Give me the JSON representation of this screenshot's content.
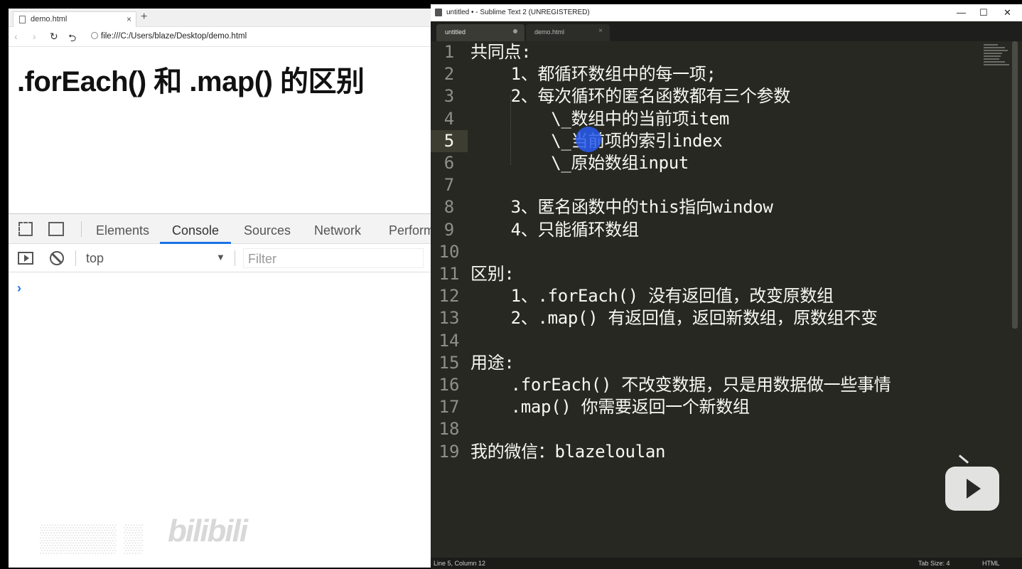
{
  "browser": {
    "tab_title": "demo.html",
    "tab_close": "×",
    "new_tab": "+",
    "nav_back": "‹",
    "nav_forward": "›",
    "nav_reload": "↻",
    "nav_home": "⮌",
    "url": "file:///C:/Users/blaze/Desktop/demo.html",
    "heading": ".forEach() 和 .map() 的区别"
  },
  "devtools": {
    "tabs": [
      "Elements",
      "Console",
      "Sources",
      "Network",
      "Perform"
    ],
    "active_tab": "Console",
    "context": "top",
    "filter_placeholder": "Filter",
    "prompt": "›"
  },
  "sublime": {
    "window_title": "untitled • - Sublime Text 2 (UNREGISTERED)",
    "tabs": [
      {
        "label": "untitled",
        "modified": true
      },
      {
        "label": "demo.html",
        "modified": false,
        "close": "×"
      }
    ],
    "lines": [
      "共同点:",
      "    1、都循环数组中的每一项;",
      "    2、每次循环的匿名函数都有三个参数",
      "        \\_数组中的当前项item",
      "        \\_当前项的索引index",
      "        \\_原始数组input",
      "",
      "    3、匿名函数中的this指向window",
      "    4、只能循环数组",
      "",
      "区别:",
      "    1、.forEach() 没有返回值，改变原数组",
      "    2、.map() 有返回值，返回新数组，原数组不变",
      "",
      "用途:",
      "    .forEach() 不改变数据，只是用数据做一些事情",
      "    .map() 你需要返回一个新数组",
      "",
      "我的微信：blazeloulan"
    ],
    "current_line": 5,
    "status_left": "Line 5, Column 12",
    "tab_size": "Tab Size: 4",
    "syntax": "HTML"
  },
  "overlay": {
    "watermark_brand": "bilibili"
  }
}
